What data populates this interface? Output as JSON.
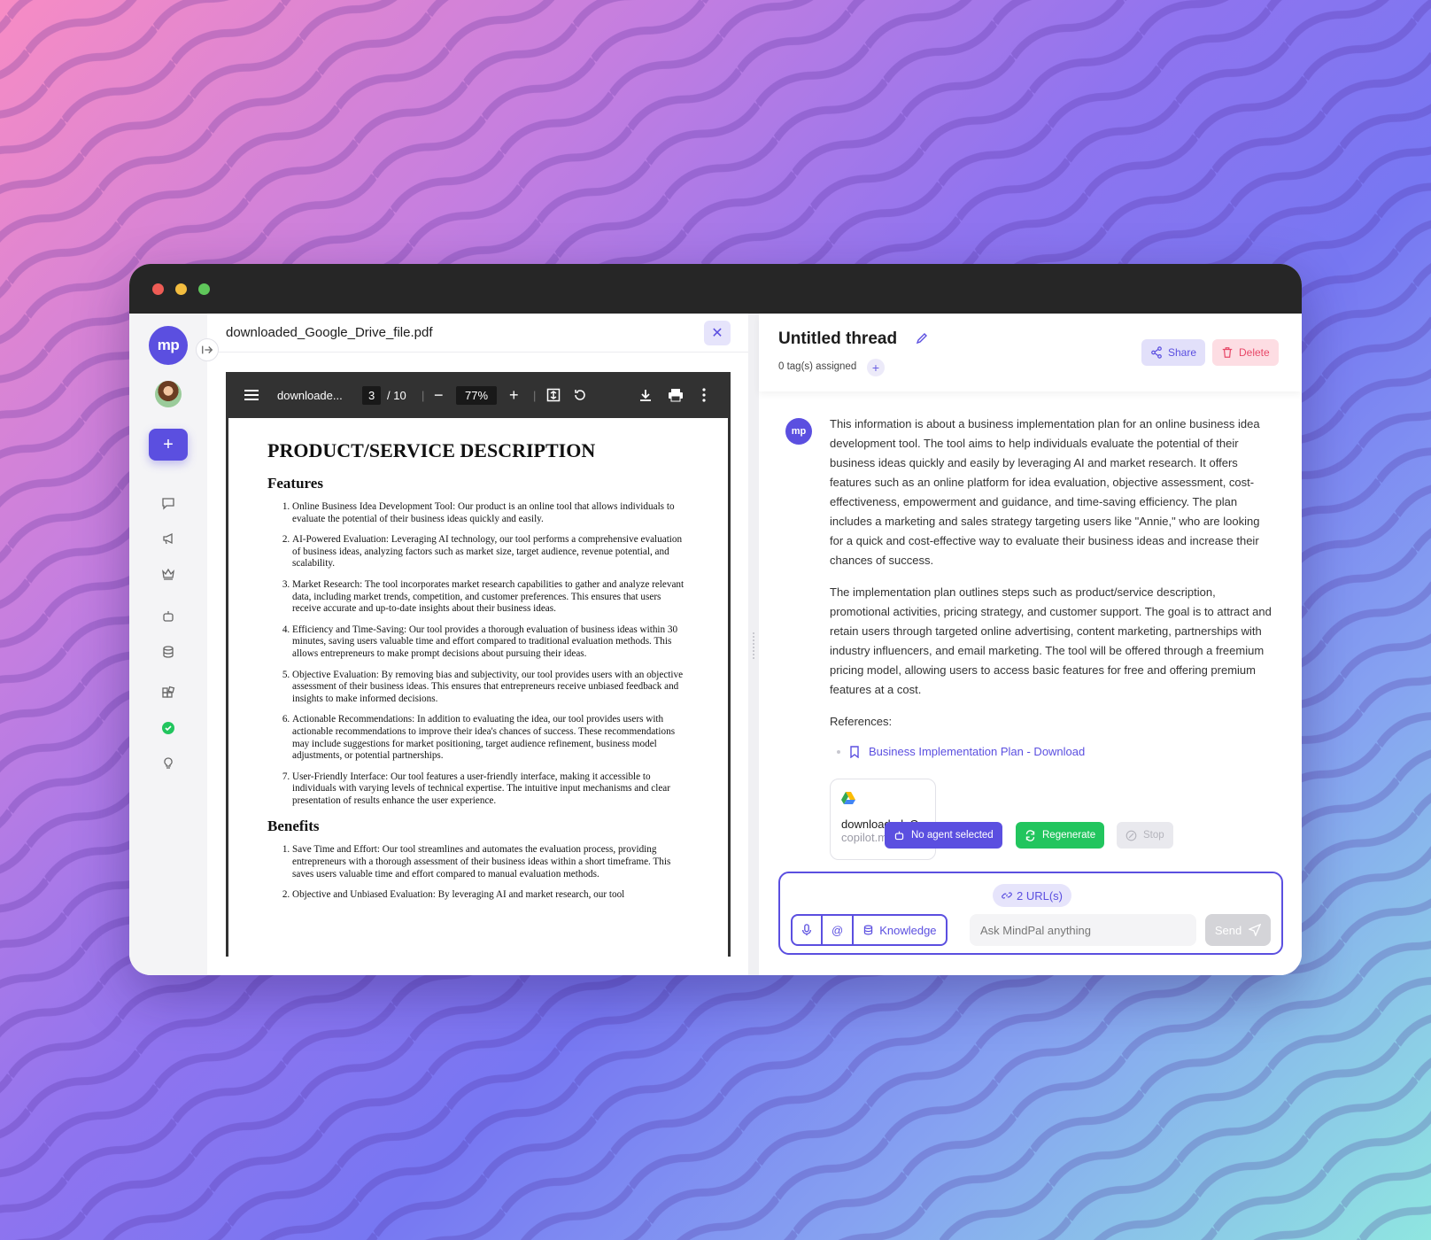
{
  "colors": {
    "accent": "#5b4fe0",
    "success": "#22c55e",
    "danger": "#e84868",
    "titlebar": "#262626"
  },
  "sidebar": {
    "logo": "mp",
    "icons": [
      "chat-icon",
      "megaphone-icon",
      "crown-icon",
      "robot-icon",
      "database-icon",
      "apps-icon",
      "check-circle-icon",
      "lightbulb-icon"
    ]
  },
  "pdf": {
    "filename": "downloaded_Google_Drive_file.pdf",
    "toolbar": {
      "short_name": "downloade...",
      "page_current": "3",
      "page_total": "/ 10",
      "zoom": "77%"
    },
    "page": {
      "heading": "PRODUCT/SERVICE DESCRIPTION",
      "features_heading": "Features",
      "features": [
        "Online Business Idea Development Tool: Our product is an online tool that allows individuals to evaluate the potential of their business ideas quickly and easily.",
        "AI-Powered Evaluation: Leveraging AI technology, our tool performs a comprehensive evaluation of business ideas, analyzing factors such as market size, target audience, revenue potential, and scalability.",
        "Market Research: The tool incorporates market research capabilities to gather and analyze relevant data, including market trends, competition, and customer preferences. This ensures that users receive accurate and up-to-date insights about their business ideas.",
        "Efficiency and Time-Saving: Our tool provides a thorough evaluation of business ideas within 30 minutes, saving users valuable time and effort compared to traditional evaluation methods. This allows entrepreneurs to make prompt decisions about pursuing their ideas.",
        "Objective Evaluation: By removing bias and subjectivity, our tool provides users with an objective assessment of their business ideas. This ensures that entrepreneurs receive unbiased feedback and insights to make informed decisions.",
        "Actionable Recommendations: In addition to evaluating the idea, our tool provides users with actionable recommendations to improve their idea's chances of success. These recommendations may include suggestions for market positioning, target audience refinement, business model adjustments, or potential partnerships.",
        "User-Friendly Interface: Our tool features a user-friendly interface, making it accessible to individuals with varying levels of technical expertise. The intuitive input mechanisms and clear presentation of results enhance the user experience."
      ],
      "benefits_heading": "Benefits",
      "benefits": [
        "Save Time and Effort: Our tool streamlines and automates the evaluation process, providing entrepreneurs with a thorough assessment of their business ideas within a short timeframe. This saves users valuable time and effort compared to manual evaluation methods.",
        "Objective and Unbiased Evaluation: By leveraging AI and market research, our tool"
      ]
    }
  },
  "chat": {
    "title": "Untitled thread",
    "tags": "0 tag(s) assigned",
    "share": "Share",
    "delete": "Delete",
    "avatar": "mp",
    "message": {
      "p1": "This information is about a business implementation plan for an online business idea development tool. The tool aims to help individuals evaluate the potential of their business ideas quickly and easily by leveraging AI and market research. It offers features such as an online platform for idea evaluation, objective assessment, cost-effectiveness, empowerment and guidance, and time-saving efficiency. The plan includes a marketing and sales strategy targeting users like \"Annie,\" who are looking for a quick and cost-effective way to evaluate their business ideas and increase their chances of success.",
      "p2": "The implementation plan outlines steps such as product/service description, promotional activities, pricing strategy, and customer support. The goal is to attract and retain users through targeted online advertising, content marketing, partnerships with industry influencers, and email marketing. The tool will be offered through a freemium pricing model, allowing users to access basic features for free and offering premium features at a cost.",
      "references_label": "References:",
      "reference": "Business Implementation Plan - Download"
    },
    "file": {
      "name": "downloaded_Goo",
      "sub": "copilot.m"
    },
    "actions": {
      "agent": "No agent selected",
      "regenerate": "Regenerate",
      "stop": "Stop"
    },
    "composer": {
      "urls": "2 URL(s)",
      "at": "@",
      "knowledge": "Knowledge",
      "placeholder": "Ask MindPal anything",
      "send": "Send"
    }
  }
}
